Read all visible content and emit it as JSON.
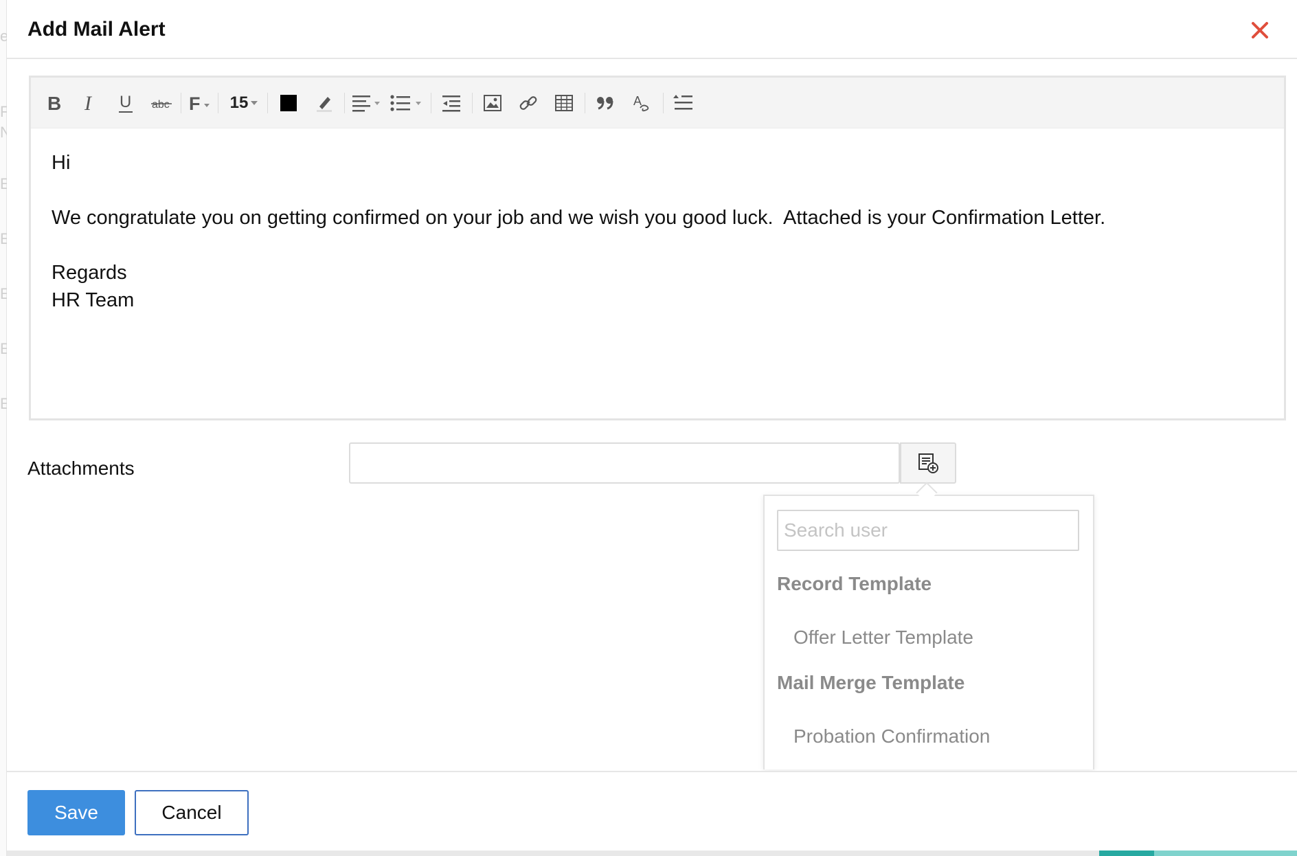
{
  "dialog": {
    "title": "Add Mail Alert",
    "close_icon": "close-icon",
    "accent_close_color": "#e04e3c"
  },
  "editor": {
    "toolbar": {
      "font_size": "15",
      "text_color": "#000000",
      "icons": [
        "bold-icon",
        "italic-icon",
        "underline-icon",
        "strikethrough-icon",
        "font-family-icon",
        "font-size-dropdown",
        "text-color-icon",
        "highlight-icon",
        "align-icon",
        "list-icon",
        "indent-icon",
        "image-icon",
        "link-icon",
        "table-icon",
        "quote-icon",
        "spellcheck-icon",
        "line-spacing-icon"
      ]
    },
    "body": {
      "line1": "Hi",
      "line2": "We congratulate you on getting confirmed on your job and we wish you good luck.  Attached is your Confirmation Letter.",
      "line3": "Regards",
      "line4": "HR Team"
    }
  },
  "attachments": {
    "label": "Attachments",
    "value": "",
    "button_icon": "insert-template-icon"
  },
  "dropdown": {
    "search_placeholder": "Search user",
    "groups": [
      {
        "label": "Record Template",
        "items": [
          "Offer Letter Template"
        ]
      },
      {
        "label": "Mail Merge Template",
        "items": [
          "Probation Confirmation"
        ]
      }
    ]
  },
  "footer": {
    "save_label": "Save",
    "cancel_label": "Cancel",
    "save_color": "#3d8ede"
  }
}
